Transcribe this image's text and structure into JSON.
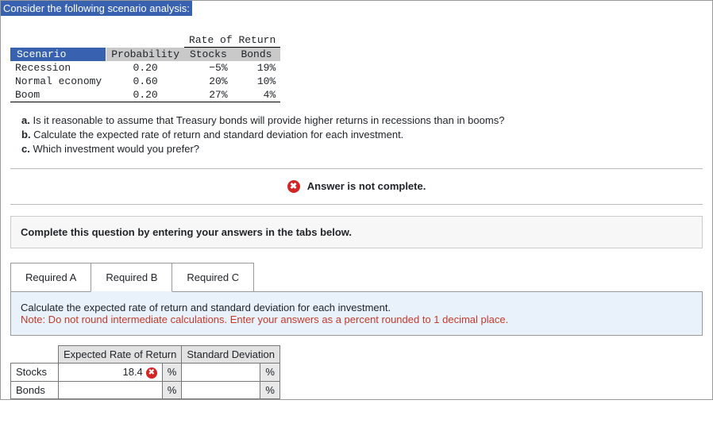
{
  "title": "Consider the following scenario analysis:",
  "data_table": {
    "rate_header": "Rate of Return",
    "cols": {
      "scenario": "Scenario",
      "prob": "Probability",
      "stocks": "Stocks",
      "bonds": "Bonds"
    },
    "rows": [
      {
        "scenario": "Recession",
        "prob": "0.20",
        "stocks": "−5%",
        "bonds": "19%"
      },
      {
        "scenario": "Normal economy",
        "prob": "0.60",
        "stocks": "20%",
        "bonds": "10%"
      },
      {
        "scenario": "Boom",
        "prob": "0.20",
        "stocks": "27%",
        "bonds": "4%"
      }
    ]
  },
  "questions": {
    "a_label": "a.",
    "a": " Is it reasonable to assume that Treasury bonds will provide higher returns in recessions than in booms?",
    "b_label": "b.",
    "b": " Calculate the expected rate of return and standard deviation for each investment.",
    "c_label": "c.",
    "c": " Which investment would you prefer?"
  },
  "alert": "Answer is not complete.",
  "instruction": "Complete this question by entering your answers in the tabs below.",
  "tabs": {
    "a": "Required A",
    "b": "Required B",
    "c": "Required C"
  },
  "panel": {
    "line1": "Calculate the expected rate of return and standard deviation for each investment.",
    "note": "Note: Do not round intermediate calculations. Enter your answers as a percent rounded to 1 decimal place."
  },
  "answer": {
    "col1": "Expected Rate of Return",
    "col2": "Standard Deviation",
    "row1": "Stocks",
    "row2": "Bonds",
    "stocks_expected": "18.4",
    "unit": "%"
  }
}
